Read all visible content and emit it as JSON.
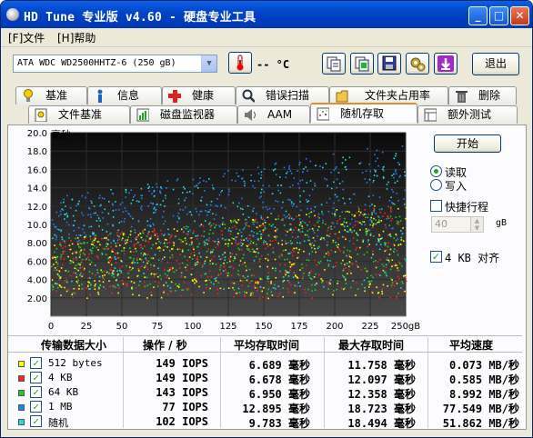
{
  "window": {
    "title": "HD Tune 专业版 v4.60 - 硬盘专业工具"
  },
  "menu": [
    {
      "label": "[F]文件"
    },
    {
      "label": "[H]帮助"
    }
  ],
  "toolbar": {
    "drive_label": "ATA    WDC WD2500HHTZ-6 (250 gB)",
    "temperature": "-- °C",
    "exit_label": "退出"
  },
  "tabs_row1": [
    {
      "label": "基准",
      "icon": "benchmark-icon"
    },
    {
      "label": "信息",
      "icon": "info-icon"
    },
    {
      "label": "健康",
      "icon": "health-icon"
    },
    {
      "label": "错误扫描",
      "icon": "error-scan-icon"
    },
    {
      "label": "文件夹占用率",
      "icon": "folder-icon"
    },
    {
      "label": "删除",
      "icon": "trash-icon"
    }
  ],
  "tabs_row2": [
    {
      "label": "文件基准",
      "icon": "file-benchmark-icon"
    },
    {
      "label": "磁盘监视器",
      "icon": "disk-monitor-icon"
    },
    {
      "label": "AAM",
      "icon": "speaker-icon"
    },
    {
      "label": "随机存取",
      "icon": "random-access-icon",
      "active": true
    },
    {
      "label": "额外测试",
      "icon": "extra-test-icon"
    }
  ],
  "controls": {
    "start_label": "开始",
    "read_label": "读取",
    "write_label": "写入",
    "short_stroke_label": "快捷行程",
    "short_stroke_value": "40",
    "short_stroke_unit": "gB",
    "align_label": "4 KB 对齐"
  },
  "table": {
    "headers": [
      "传输数据大小",
      "操作 / 秒",
      "平均存取时间",
      "最大存取时间",
      "平均速度"
    ],
    "rows": [
      {
        "size": "512 bytes",
        "ops": "149 IOPS",
        "avg": "6.689 毫秒",
        "max": "11.758 毫秒",
        "speed": "0.073 MB/秒",
        "color": "#ffff00"
      },
      {
        "size": "4 KB",
        "ops": "149 IOPS",
        "avg": "6.678 毫秒",
        "max": "12.097 毫秒",
        "speed": "0.585 MB/秒",
        "color": "#ff2020"
      },
      {
        "size": "64 KB",
        "ops": "143 IOPS",
        "avg": "6.950 毫秒",
        "max": "12.358 毫秒",
        "speed": "8.992 MB/秒",
        "color": "#20d020"
      },
      {
        "size": "1 MB",
        "ops": "77 IOPS",
        "avg": "12.895 毫秒",
        "max": "18.723 毫秒",
        "speed": "77.549 MB/秒",
        "color": "#2080ff"
      },
      {
        "size": "随机",
        "ops": "102 IOPS",
        "avg": "9.783 毫秒",
        "max": "18.494 毫秒",
        "speed": "51.862 MB/秒",
        "color": "#20e0e0"
      }
    ]
  },
  "chart_data": {
    "type": "scatter",
    "ylabel": "毫秒",
    "xlabel": "",
    "x_ticks": [
      "0",
      "25",
      "50",
      "75",
      "100",
      "125",
      "150",
      "175",
      "200",
      "225",
      "250gB"
    ],
    "y_ticks": [
      "2.00",
      "4.00",
      "6.00",
      "8.00",
      "10.0",
      "12.0",
      "14.0",
      "16.0",
      "18.0",
      "20.0"
    ],
    "xlim": [
      0,
      250
    ],
    "ylim": [
      0,
      20
    ],
    "grid": true,
    "background": "#000000",
    "series": [
      {
        "name": "512 bytes",
        "color": "#ffff00",
        "y_min": 2.0,
        "y_max_start": 8.5,
        "y_max_end": 12.5
      },
      {
        "name": "4 KB",
        "color": "#ff2020",
        "y_min": 2.0,
        "y_max_start": 8.5,
        "y_max_end": 12.5
      },
      {
        "name": "64 KB",
        "color": "#20d020",
        "y_min": 2.5,
        "y_max_start": 8.5,
        "y_max_end": 12.5
      },
      {
        "name": "1 MB",
        "color": "#2080ff",
        "y_min": 8.0,
        "y_max_start": 13.0,
        "y_max_end": 19.0
      },
      {
        "name": "随机",
        "color": "#20e0e0",
        "y_min": 3.0,
        "y_max_start": 13.0,
        "y_max_end": 18.5
      }
    ]
  }
}
